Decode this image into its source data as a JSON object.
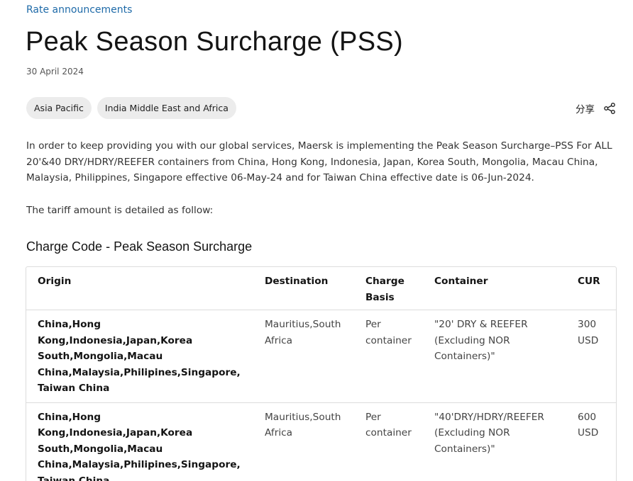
{
  "breadcrumb": "Rate announcements",
  "title": "Peak Season Surcharge (PSS)",
  "date": "30 April 2024",
  "tags": [
    "Asia Pacific",
    "India Middle East and Africa"
  ],
  "share_label": "分享",
  "body": "In order to keep providing you with our global services, Maersk is implementing the Peak Season Surcharge–PSS For ALL 20'&40 DRY/HDRY/REEFER containers from China, Hong Kong, Indonesia, Japan, Korea South, Mongolia, Macau China, Malaysia, Philippines, Singapore effective 06-May-24 and for Taiwan China effective date is 06-Jun-2024.",
  "follow": "The tariff amount is detailed as follow:",
  "section_title": "Charge Code - Peak Season Surcharge",
  "table": {
    "headers": [
      "Origin",
      "Destination",
      "Charge Basis",
      "Container",
      "CUR"
    ],
    "rows": [
      [
        "China,Hong Kong,Indonesia,Japan,Korea South,Mongolia,Macau China,Malaysia,Philipines,Singapore, Taiwan China",
        "Mauritius,South Africa",
        "Per container",
        "\"20' DRY & REEFER (Excluding NOR Containers)\"",
        "300 USD"
      ],
      [
        "China,Hong Kong,Indonesia,Japan,Korea South,Mongolia,Macau China,Malaysia,Philipines,Singapore, Taiwan China",
        "Mauritius,South Africa",
        "Per container",
        "\"40'DRY/HDRY/REEFER (Excluding NOR Containers)\"",
        "600 USD"
      ]
    ]
  },
  "icons": {
    "share": "share-icon"
  },
  "colors": {
    "link": "#1e6aa8",
    "tag_bg": "#ececec",
    "border": "#dcdcdc"
  }
}
